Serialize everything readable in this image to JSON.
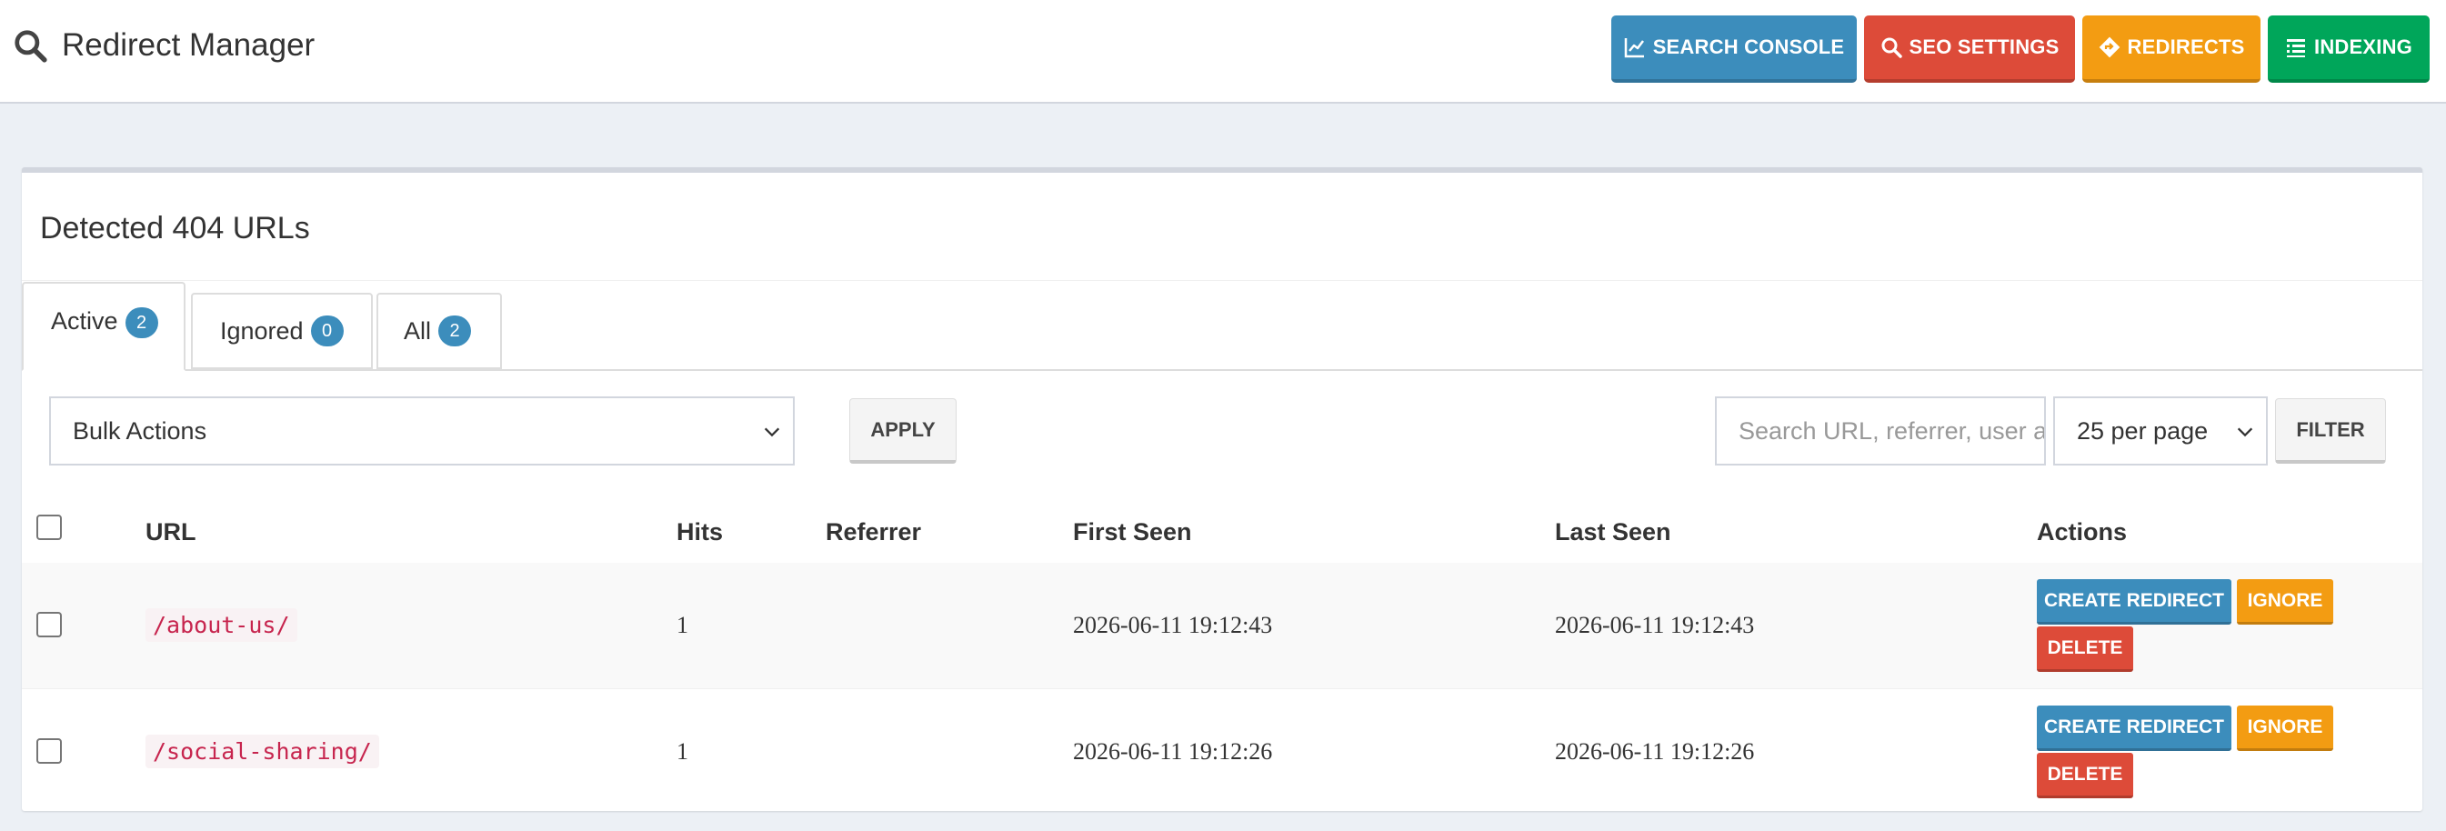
{
  "header": {
    "title": "Redirect Manager",
    "buttons": [
      {
        "label": "SEARCH CONSOLE",
        "icon": "chart-line-icon",
        "color": "#3c8dbc"
      },
      {
        "label": "SEO SETTINGS",
        "icon": "search-icon",
        "color": "#dd4b39"
      },
      {
        "label": "REDIRECTS",
        "icon": "diamond-arrow-icon",
        "color": "#f39c12"
      },
      {
        "label": "INDEXING",
        "icon": "list-icon",
        "color": "#00a65a"
      }
    ]
  },
  "panel": {
    "title": "Detected 404 URLs",
    "tabs": [
      {
        "label": "Active",
        "count": "2",
        "active": true
      },
      {
        "label": "Ignored",
        "count": "0",
        "active": false
      },
      {
        "label": "All",
        "count": "2",
        "active": false
      }
    ]
  },
  "controls": {
    "bulk_actions": "Bulk Actions",
    "apply": "APPLY",
    "search_placeholder": "Search URL, referrer, user a",
    "per_page": "25 per page",
    "filter": "FILTER"
  },
  "table": {
    "columns": [
      "URL",
      "Hits",
      "Referrer",
      "First Seen",
      "Last Seen",
      "Actions"
    ],
    "rows": [
      {
        "url": "/about-us/",
        "hits": "1",
        "referrer": "",
        "first_seen": "2026-06-11 19:12:43",
        "last_seen": "2026-06-11 19:12:43"
      },
      {
        "url": "/social-sharing/",
        "hits": "1",
        "referrer": "",
        "first_seen": "2026-06-11 19:12:26",
        "last_seen": "2026-06-11 19:12:26"
      }
    ],
    "actions": {
      "create": "CREATE REDIRECT",
      "ignore": "IGNORE",
      "delete": "DELETE"
    }
  }
}
